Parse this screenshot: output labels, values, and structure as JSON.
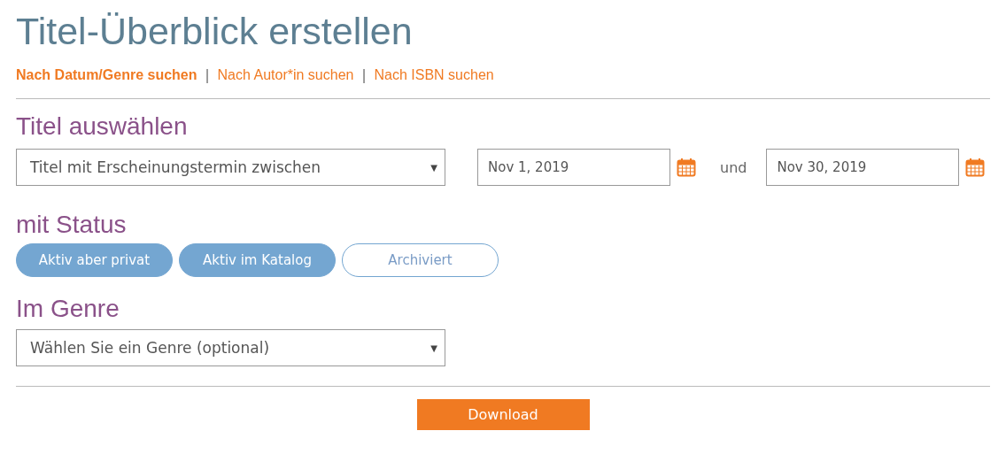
{
  "title": "Titel-Überblick erstellen",
  "search_tabs": [
    {
      "label": "Nach Datum/Genre suchen",
      "selected": true
    },
    {
      "label": "Nach Autor*in suchen",
      "selected": false
    },
    {
      "label": "Nach ISBN suchen",
      "selected": false
    }
  ],
  "tab_separator": "|",
  "title_section": {
    "heading": "Titel auswählen",
    "select": {
      "value": "Titel mit Erscheinungstermin zwischen",
      "caret": "▼"
    },
    "date_from": {
      "value": "Nov 1, 2019"
    },
    "conjunction": "und",
    "date_to": {
      "value": "Nov 30, 2019"
    }
  },
  "status_section": {
    "heading": "mit Status",
    "options": [
      {
        "label": "Aktiv aber privat",
        "selected": true
      },
      {
        "label": "Aktiv im Katalog",
        "selected": true
      },
      {
        "label": "Archiviert",
        "selected": false
      }
    ]
  },
  "genre_section": {
    "heading": "Im Genre",
    "select": {
      "placeholder": "Wählen Sie ein Genre (optional)",
      "caret": "▼"
    }
  },
  "download_button": "Download"
}
